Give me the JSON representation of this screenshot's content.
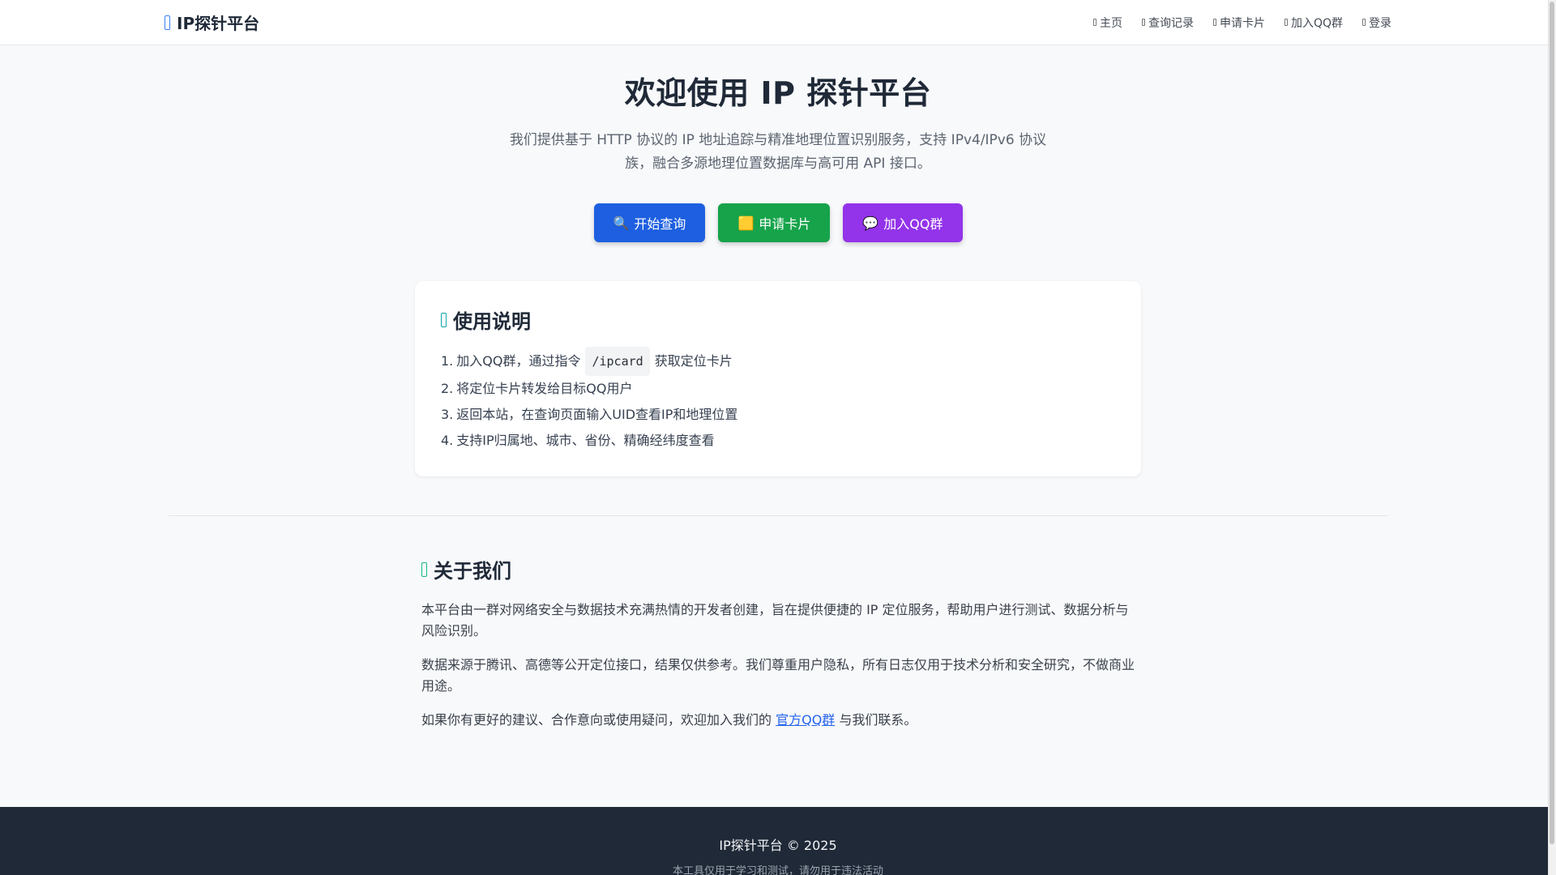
{
  "header": {
    "brand": "IP探针平台",
    "nav": [
      {
        "label": "主页",
        "icon": "home-icon"
      },
      {
        "label": "查询记录",
        "icon": "history-icon"
      },
      {
        "label": "申请卡片",
        "icon": "card-icon"
      },
      {
        "label": "加入QQ群",
        "icon": "group-icon"
      },
      {
        "label": "登录",
        "icon": "login-icon"
      }
    ]
  },
  "hero": {
    "title": "欢迎使用 IP 探针平台",
    "description": "我们提供基于 HTTP 协议的 IP 地址追踪与精准地理位置识别服务，支持 IPv4/IPv6 协议族，融合多源地理位置数据库与高可用 API 接口。",
    "buttons": [
      {
        "emoji": "🔍",
        "label": "开始查询",
        "color": "#1d5fe0"
      },
      {
        "emoji": "🟨",
        "label": "申请卡片",
        "color": "#16a34a"
      },
      {
        "emoji": "💬",
        "label": "加入QQ群",
        "color": "#9333ea"
      }
    ]
  },
  "usage": {
    "title": "使用说明",
    "items": [
      {
        "num": "1.",
        "before": "加入QQ群，通过指令",
        "code": "/ipcard",
        "after": "获取定位卡片"
      },
      {
        "num": "2.",
        "text": "将定位卡片转发给目标QQ用户"
      },
      {
        "num": "3.",
        "text": "返回本站，在查询页面输入UID查看IP和地理位置"
      },
      {
        "num": "4.",
        "text": "支持IP归属地、城市、省份、精确经纬度查看"
      }
    ]
  },
  "about": {
    "title": "关于我们",
    "p1": "本平台由一群对网络安全与数据技术充满热情的开发者创建，旨在提供便捷的 IP 定位服务，帮助用户进行测试、数据分析与风险识别。",
    "p2": "数据来源于腾讯、高德等公开定位接口，结果仅供参考。我们尊重用户隐私，所有日志仅用于技术分析和安全研究，不做商业用途。",
    "p3_before": "如果你有更好的建议、合作意向或使用疑问，欢迎加入我们的",
    "p3_link": "官方QQ群",
    "p3_after": "与我们联系。"
  },
  "footer": {
    "main": "IP探针平台 © 2025",
    "sub": "本工具仅用于学习和测试，请勿用于违法活动"
  }
}
